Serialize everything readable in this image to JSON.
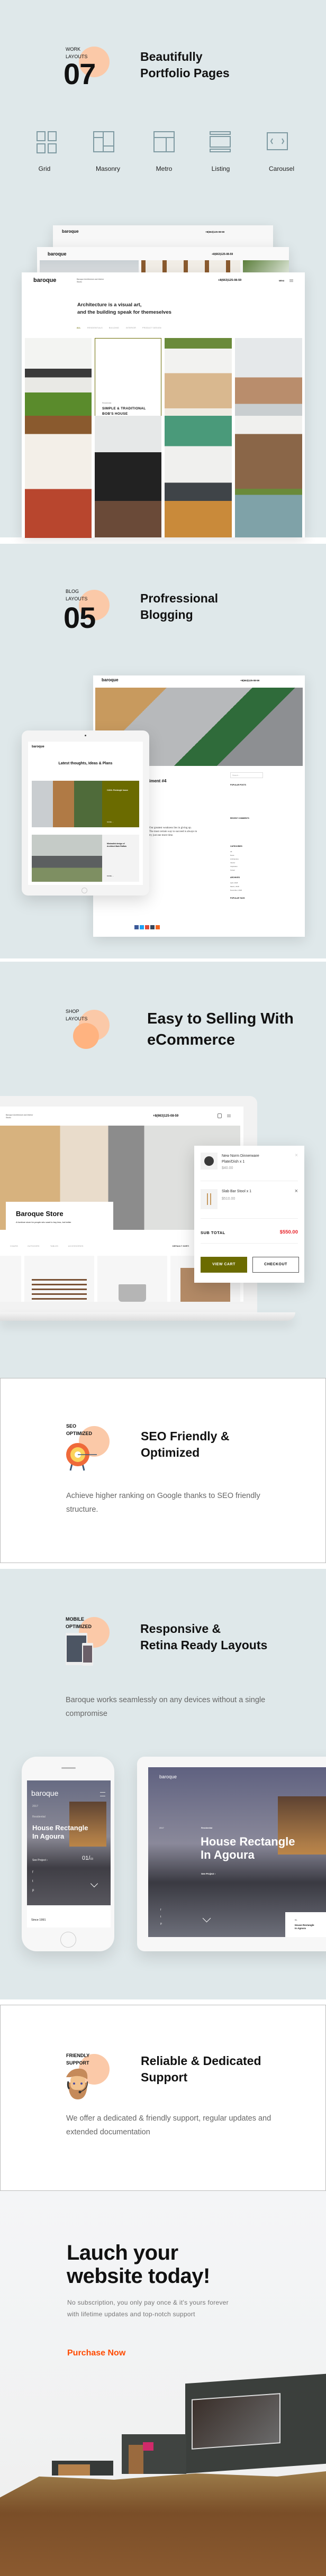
{
  "colors": {
    "section_bg": "#dfe8ea",
    "accent_circle": "#fbc9a8",
    "accent_circle_dark": "#ffb380",
    "olive": "#6b6b00",
    "price_red": "#e8232a",
    "purchase_orange": "#ff4a00"
  },
  "portfolio": {
    "label": [
      "WORK",
      "LAYOUTS"
    ],
    "number": "07",
    "title": [
      "Beautifully",
      "Portfolio Pages"
    ],
    "layouts": [
      {
        "label": "Grid",
        "icon": "grid-icon"
      },
      {
        "label": "Masonry",
        "icon": "masonry-icon"
      },
      {
        "label": "Metro",
        "icon": "metro-icon"
      },
      {
        "label": "Listing",
        "icon": "listing-icon"
      },
      {
        "label": "Carousel",
        "icon": "carousel-icon"
      }
    ],
    "mock": {
      "logo": "baroque",
      "tagline": "Baroque Architecture and Interior Studio",
      "phone": "+8(663)125-08-59",
      "menu": "MENU",
      "headline": [
        "Architecture is a visual art,",
        "and the building speak for themeselves"
      ],
      "filters": [
        "ALL",
        "RESIDENTIALS",
        "BUILDING",
        "INTERIOR",
        "PRODUCT DESIGN"
      ],
      "feature_category": "Residential",
      "feature_title": [
        "SIMPLE & TRADITIONAL",
        "BOB'S HOUSE"
      ]
    }
  },
  "blog": {
    "label": [
      "BLOG",
      "LAYOUTS"
    ],
    "number": "05",
    "title": [
      "Profressional",
      "Blogging"
    ],
    "desktop": {
      "logo": "baroque",
      "phone": "+8(663)125-08-59",
      "post_title": "iment #4",
      "quote": [
        "Our greatest weakness lies in giving up.",
        "The most certain way to succeed is always to",
        "try just one more time."
      ],
      "search_placeholder": "Search...",
      "sidebar": [
        "POPULAR POSTS",
        "RECENT COMMENTS",
        "CATEGORIES",
        "ARCHIVES",
        "POPULAR TAGS"
      ],
      "categories": [
        "All",
        "News",
        "Architecture",
        "Interior",
        "Inspiration",
        "Career"
      ],
      "archives": [
        "April, 2018",
        "March, 2018",
        "November, 2018"
      ]
    },
    "tablet": {
      "logo": "baroque",
      "heading": "Latest thoughts, Ideas & Plans",
      "post1_title": "CASA: Rectangle house",
      "post2_title": [
        "Minimalist design of",
        "Architect Mark Raffalo"
      ],
      "more": "MORE →"
    }
  },
  "shop": {
    "label": [
      "SHOP",
      "LAYOUTS"
    ],
    "title": [
      "Easy to Selling With",
      "eCommerce"
    ],
    "mock": {
      "tagline": "Baroque Architecture and Interior Studio",
      "phone": "+8(663)125-08-59",
      "store_title": "Baroque Store",
      "store_subtitle": "A furniture store for people who want to buy less, but better",
      "filters": [
        "CHAIRS",
        "OUTDOORS",
        "TABLES",
        "ACCESSORIES"
      ],
      "sorting": "DEFAULT SORTI"
    },
    "cart": {
      "items": [
        {
          "name": [
            "New Norm Dinnerware",
            "Plate/Dish x 1"
          ],
          "price": "$40.00"
        },
        {
          "name": [
            "Slab Bar Stool x 1"
          ],
          "price": "$510.00"
        }
      ],
      "subtotal_label": "SUB TOTAL",
      "subtotal": "$550.00",
      "view_cart": "VIEW CART",
      "checkout": "CHECKOUT"
    }
  },
  "seo": {
    "label": [
      "SEO",
      "OPTIMIZED"
    ],
    "title": [
      "SEO Friendly &",
      "Optimized"
    ],
    "desc": "Achieve higher ranking on Google thanks to SEO friendly structure."
  },
  "mobile": {
    "label": [
      "MOBILE",
      "OPTIMIZED"
    ],
    "title": [
      "Responsive &",
      "Retina Ready Layouts"
    ],
    "desc": "Baroque works seamlessly on any devices without a single compromise",
    "phone": {
      "logo": "baroque",
      "year": "2017",
      "category": "Residential",
      "headline": [
        "House Rectangle",
        "In Agoura"
      ],
      "see": "See Project ›",
      "counter": "01/",
      "total": "03",
      "since": "Since 1991"
    },
    "tablet": {
      "logo": "baroque",
      "year": "2017",
      "category": "Residential",
      "headline": [
        "House Rectangle",
        "In Agoura"
      ],
      "see": "See Project ›",
      "card_num": "01.",
      "card_title": [
        "House Rectangle",
        "In Agoura"
      ]
    }
  },
  "support": {
    "label": [
      "FRIENDLY",
      "SUPPORT"
    ],
    "title": [
      "Reliable & Dedicated",
      "Support"
    ],
    "desc": "We offer a dedicated & friendly support, regular updates and extended documentation"
  },
  "cta": {
    "headline": [
      "Lauch your",
      "website today!"
    ],
    "desc": [
      "No subscription, you only pay once & it's yours forever",
      "with lifetime updates and top-notch support"
    ],
    "button": "Purchase Now"
  }
}
